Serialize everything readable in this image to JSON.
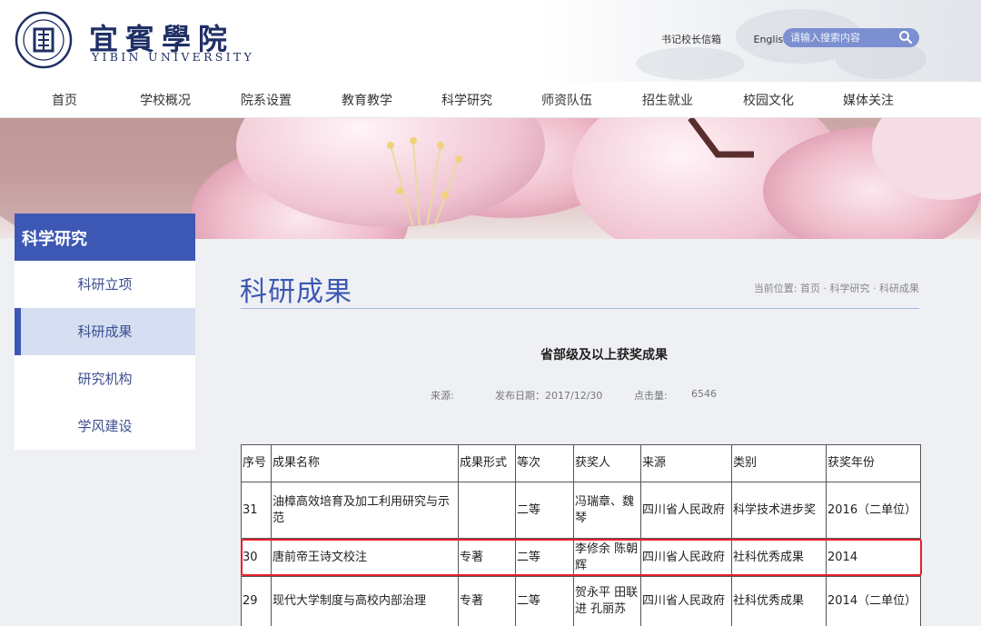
{
  "header": {
    "logo_cn": "宜賓學院",
    "logo_en": "YIBIN UNIVERSITY",
    "links": [
      "书记校长信箱",
      "English"
    ],
    "search_placeholder": "请输入搜索内容"
  },
  "nav": [
    "首页",
    "学校概况",
    "院系设置",
    "教育教学",
    "科学研究",
    "师资队伍",
    "招生就业",
    "校园文化",
    "媒体关注"
  ],
  "sidebar": {
    "title": "科学研究",
    "items": [
      {
        "label": "科研立项",
        "active": false
      },
      {
        "label": "科研成果",
        "active": true
      },
      {
        "label": "研究机构",
        "active": false
      },
      {
        "label": "学风建设",
        "active": false
      }
    ]
  },
  "main": {
    "page_title": "科研成果",
    "breadcrumb": "当前位置: 首页 · 科学研究 · 科研成果",
    "article_title": "省部级及以上获奖成果",
    "meta": {
      "source_label": "来源:",
      "date": "发布日期：2017/12/30",
      "views_label": "点击量:",
      "views": "6546"
    }
  },
  "table": {
    "headers": [
      "序号",
      "成果名称",
      "成果形式",
      "等次",
      "获奖人",
      "来源",
      "类别",
      "获奖年份"
    ],
    "rows": [
      [
        "31",
        "油樟高效培育及加工利用研究与示范",
        "",
        "二等",
        "冯瑞章、魏琴",
        "四川省人民政府",
        "科学技术进步奖",
        "2016（二单位）"
      ],
      [
        "30",
        "唐前帝王诗文校注",
        "专著",
        "二等",
        "李修余 陈朝辉",
        "四川省人民政府",
        "社科优秀成果",
        "2014"
      ],
      [
        "29",
        "现代大学制度与高校内部治理",
        "专著",
        "二等",
        "贺永平 田联进 孔丽苏",
        "四川省人民政府",
        "社科优秀成果",
        "2014（二单位）"
      ]
    ],
    "highlighted_row": 1
  },
  "colors": {
    "brand_blue": "#3d58b4",
    "search_bg": "#7b8fd1",
    "highlight_red": "#e8202a"
  }
}
